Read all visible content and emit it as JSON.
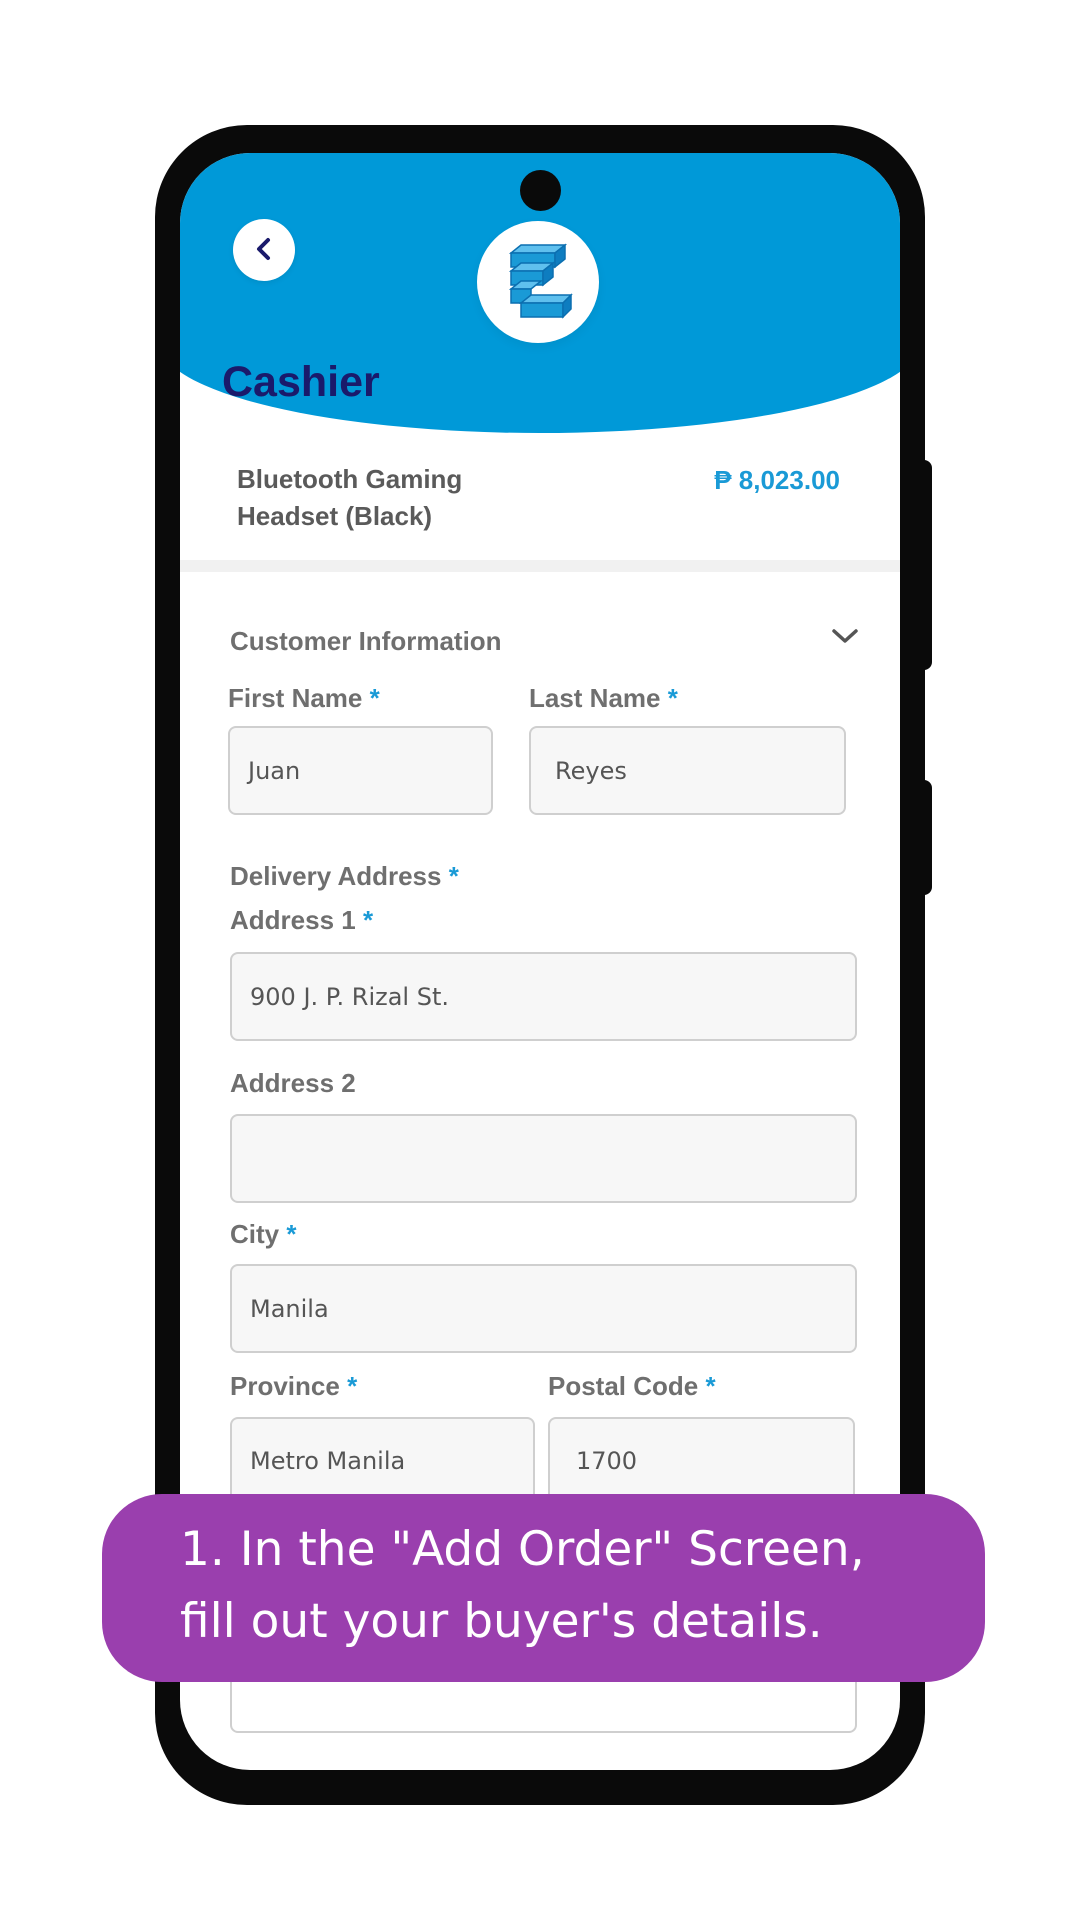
{
  "screen": {
    "title": "Cashier"
  },
  "product": {
    "name": "Bluetooth Gaming Headset (Black)",
    "price": "₱ 8,023.00"
  },
  "section": {
    "title": "Customer Information"
  },
  "form": {
    "required_marker": "*",
    "first_name": {
      "label": "First Name",
      "value": "Juan"
    },
    "last_name": {
      "label": "Last Name",
      "value": "Reyes"
    },
    "delivery_address": {
      "label": "Delivery Address"
    },
    "address1": {
      "label": "Address 1",
      "value": "900 J. P. Rizal St."
    },
    "address2": {
      "label": "Address 2",
      "value": ""
    },
    "city": {
      "label": "City",
      "value": "Manila"
    },
    "province": {
      "label": "Province",
      "value": "Metro Manila"
    },
    "postal_code": {
      "label": "Postal Code",
      "value": "1700"
    }
  },
  "banner": {
    "line1": "1. In the \"Add Order\" Screen,",
    "line2": "fill out your buyer's details."
  },
  "colors": {
    "header_blue": "#0099d8",
    "title_navy": "#1a1a6b",
    "accent_blue": "#1a9ad6",
    "banner_purple": "#9a3fae"
  },
  "icons": {
    "back": "chevron-left-icon",
    "logo": "stacked-blocks-logo",
    "section_toggle": "chevron-down-icon"
  }
}
